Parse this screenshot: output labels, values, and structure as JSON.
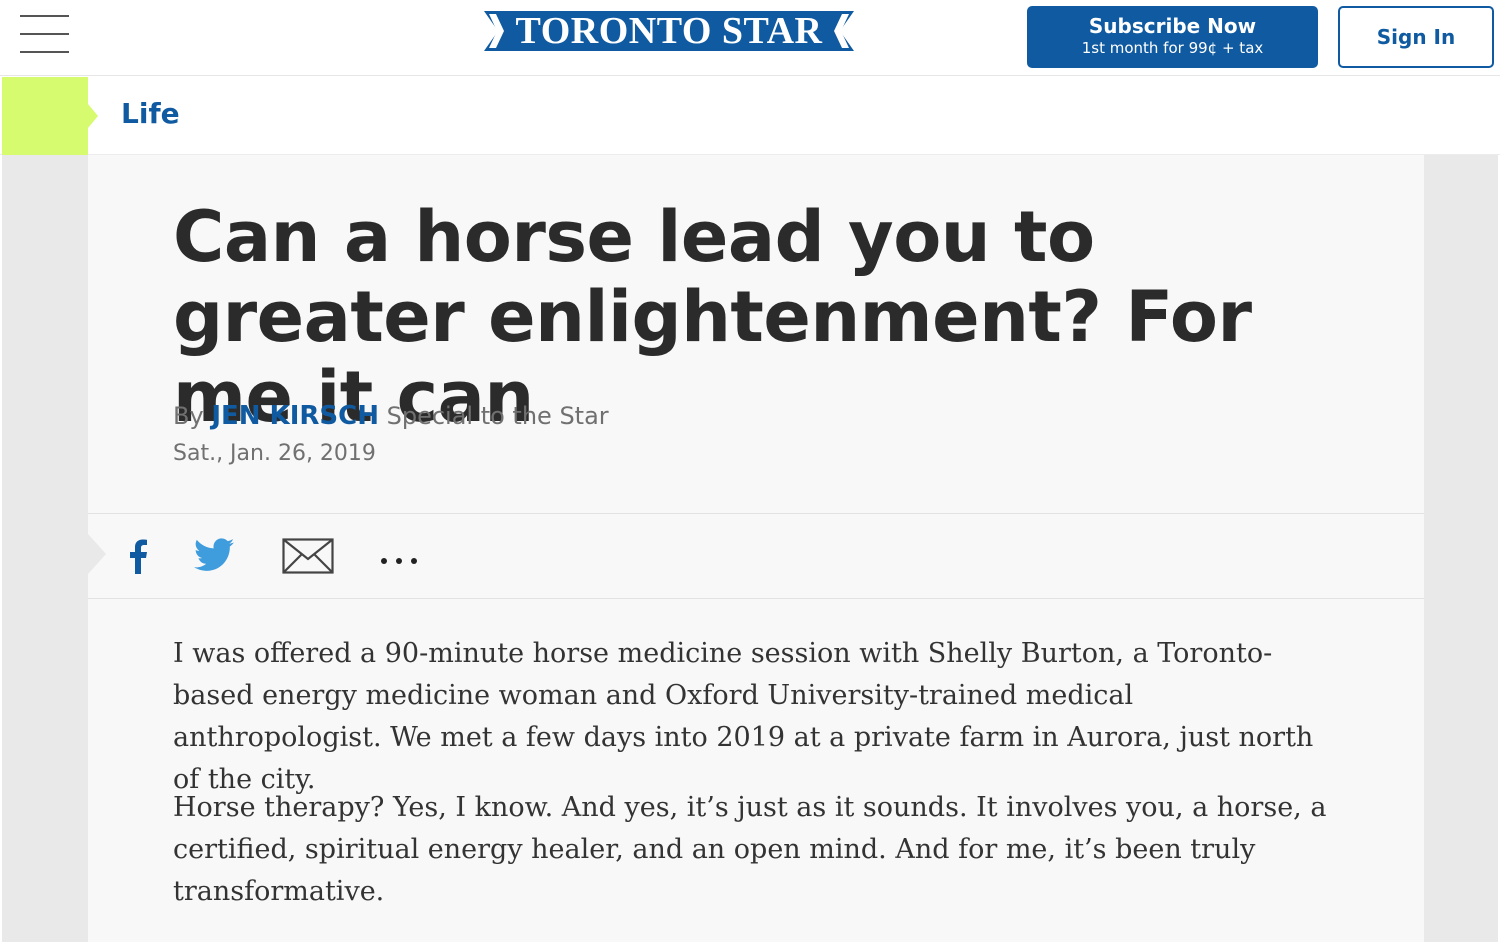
{
  "header": {
    "logo_text": "TORONTO STAR",
    "subscribe_title": "Subscribe Now",
    "subscribe_subtitle": "1st month for 99¢ + tax",
    "signin_label": "Sign In",
    "menu_icon": "hamburger-icon"
  },
  "section": {
    "label": "Life",
    "accent_color": "#d6fb6e"
  },
  "article": {
    "headline": "Can a horse lead you to greater enlightenment? For me it can",
    "byline_prefix": "By",
    "author": "JEN KIRSCH",
    "author_role": "Special to the Star",
    "date": "Sat., Jan. 26, 2019",
    "paragraphs": [
      "I was offered a 90-minute horse medicine session with Shelly Burton, a Toronto-based energy medicine woman and Oxford University-trained medical anthropologist. We met a few days into 2019 at a private farm in Aurora, just north of the city.",
      "Horse therapy? Yes, I know. And yes, it’s just as it sounds. It involves you, a horse, a certified, spiritual energy healer, and an open mind. And for me, it’s been truly transformative."
    ]
  },
  "share": {
    "icons": [
      "facebook-icon",
      "twitter-icon",
      "email-icon",
      "more-icon"
    ]
  },
  "colors": {
    "brand_blue": "#0f5aa0",
    "twitter_blue": "#3f9cdd"
  }
}
